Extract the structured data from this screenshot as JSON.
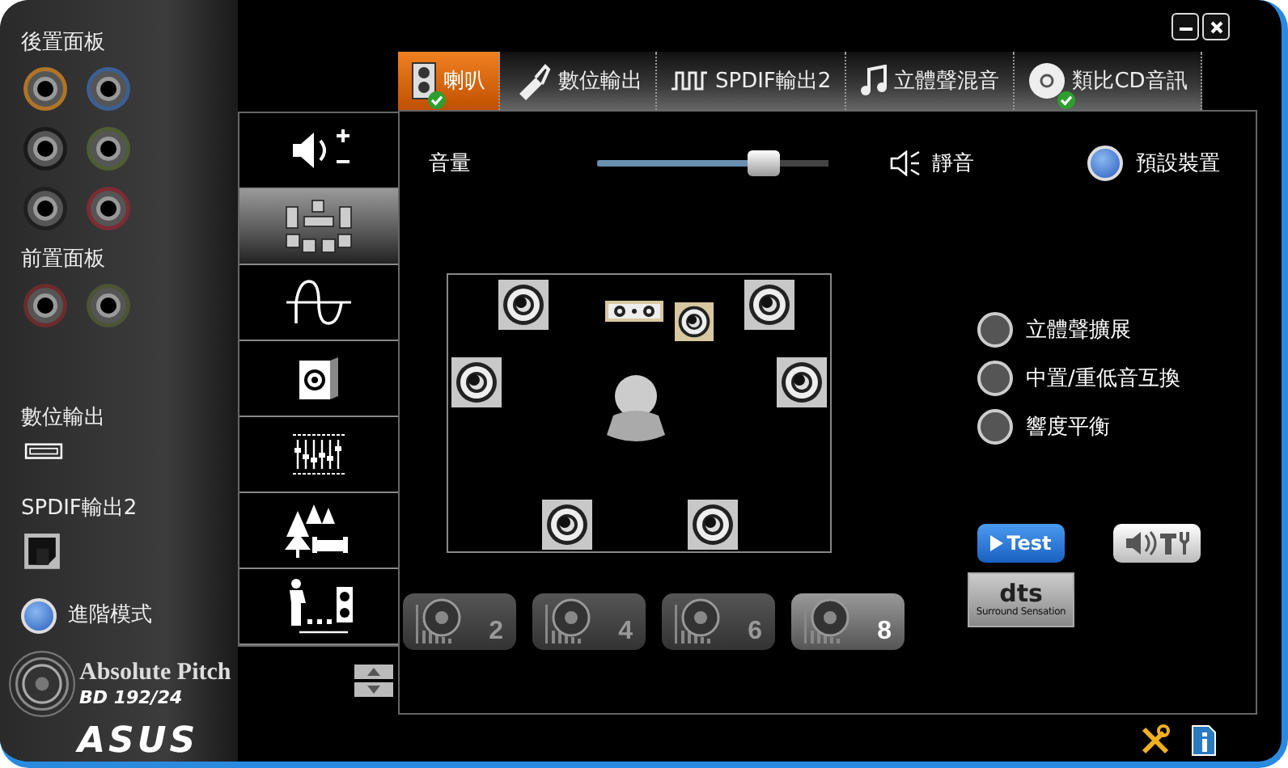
{
  "left_panel": {
    "rear_panel": {
      "title": "後置面板",
      "jacks": [
        {
          "color": "#b07428"
        },
        {
          "color": "#3c5f92"
        },
        {
          "color": "#1a1a1a"
        },
        {
          "color": "#505c34"
        },
        {
          "color": "#202020"
        },
        {
          "color": "#7c2c34"
        }
      ]
    },
    "front_panel": {
      "title": "前置面板",
      "jacks": [
        {
          "color": "#6c2c2c"
        },
        {
          "color": "#4c5434"
        }
      ]
    },
    "digital_output": {
      "label": "數位輸出"
    },
    "spdif_output": {
      "label": "SPDIF輸出2"
    },
    "advanced_mode": {
      "label": "進階模式",
      "selected": true
    },
    "logo": {
      "title": "Absolute Pitch",
      "subtitle": "BD 192/24",
      "brand": "ASUS"
    }
  },
  "tabs": [
    {
      "kind": "speaker",
      "label": "喇叭",
      "selected": true,
      "checked": true
    },
    {
      "kind": "usb",
      "label": "數位輸出",
      "selected": false,
      "checked": false
    },
    {
      "kind": "wave",
      "label": "SPDIF輸出2",
      "selected": false,
      "checked": false
    },
    {
      "kind": "note",
      "label": "立體聲混音",
      "selected": false,
      "checked": false
    },
    {
      "kind": "disc",
      "label": "類比CD音訊",
      "selected": false,
      "checked": true
    }
  ],
  "side_menu": [
    {
      "kind": "volume",
      "selected": false
    },
    {
      "kind": "speakers",
      "selected": true
    },
    {
      "kind": "wave",
      "selected": false
    },
    {
      "kind": "subwoofer",
      "selected": false
    },
    {
      "kind": "equalizer",
      "selected": false
    },
    {
      "kind": "environment",
      "selected": false
    },
    {
      "kind": "distance",
      "selected": false
    }
  ],
  "volume": {
    "label": "音量",
    "level": 0.72
  },
  "mute": {
    "label": "靜音"
  },
  "default_device": {
    "label": "預設裝置",
    "selected": true
  },
  "speakers": [
    {
      "kind": "front-left",
      "highlighted": false
    },
    {
      "kind": "center",
      "highlighted": true
    },
    {
      "kind": "subwoofer",
      "highlighted": true
    },
    {
      "kind": "front-right",
      "highlighted": false
    },
    {
      "kind": "side-left",
      "highlighted": false
    },
    {
      "kind": "side-right",
      "highlighted": false
    },
    {
      "kind": "rear-left",
      "highlighted": false
    },
    {
      "kind": "rear-right",
      "highlighted": false
    }
  ],
  "options": [
    {
      "label": "立體聲擴展",
      "selected": false
    },
    {
      "label": "中置/重低音互換",
      "selected": false
    },
    {
      "label": "響度平衡",
      "selected": false
    }
  ],
  "test_button": {
    "label": "Test"
  },
  "dts": {
    "logo": "dts",
    "caption": "Surround Sensation"
  },
  "channels": [
    {
      "label": "2",
      "selected": false
    },
    {
      "label": "4",
      "selected": false
    },
    {
      "label": "6",
      "selected": false
    },
    {
      "label": "8",
      "selected": true
    }
  ]
}
